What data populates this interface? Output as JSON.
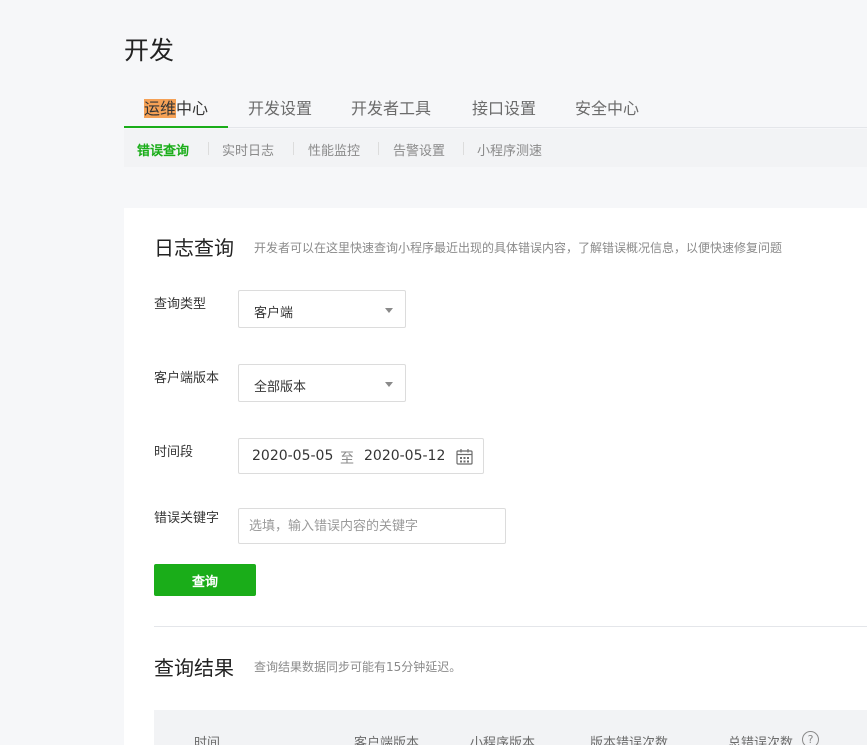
{
  "page": {
    "title": "开发"
  },
  "main_tabs": [
    {
      "label_highlight": "运维",
      "label_rest": "中心"
    },
    {
      "label": "开发设置"
    },
    {
      "label": "开发者工具"
    },
    {
      "label": "接口设置"
    },
    {
      "label": "安全中心"
    }
  ],
  "sub_tabs": [
    {
      "label": "错误查询"
    },
    {
      "label": "实时日志"
    },
    {
      "label": "性能监控"
    },
    {
      "label": "告警设置"
    },
    {
      "label": "小程序测速"
    }
  ],
  "log_query": {
    "title": "日志查询",
    "description": "开发者可以在这里快速查询小程序最近出现的具体错误内容，了解错误概况信息，以便快速修复问题"
  },
  "form": {
    "query_type": {
      "label": "查询类型",
      "value": "客户端"
    },
    "client_version": {
      "label": "客户端版本",
      "value": "全部版本"
    },
    "time_range": {
      "label": "时间段",
      "start": "2020-05-05",
      "separator": "至",
      "end": "2020-05-12"
    },
    "keyword": {
      "label": "错误关键字",
      "placeholder": "选填，输入错误内容的关键字",
      "value": ""
    },
    "submit_label": "查询"
  },
  "results": {
    "title": "查询结果",
    "description": "查询结果数据同步可能有15分钟延迟。",
    "columns": [
      "时间",
      "客户端版本",
      "小程序版本",
      "版本错误次数",
      "总错误次数"
    ],
    "help_glyph": "?"
  },
  "colors": {
    "accent": "#1aad19",
    "highlight": "#f5a156",
    "page_bg": "#f6f7f9"
  },
  "icons": {
    "dropdown": "caret-down-icon",
    "calendar": "calendar-icon",
    "help": "question-circle-icon"
  }
}
